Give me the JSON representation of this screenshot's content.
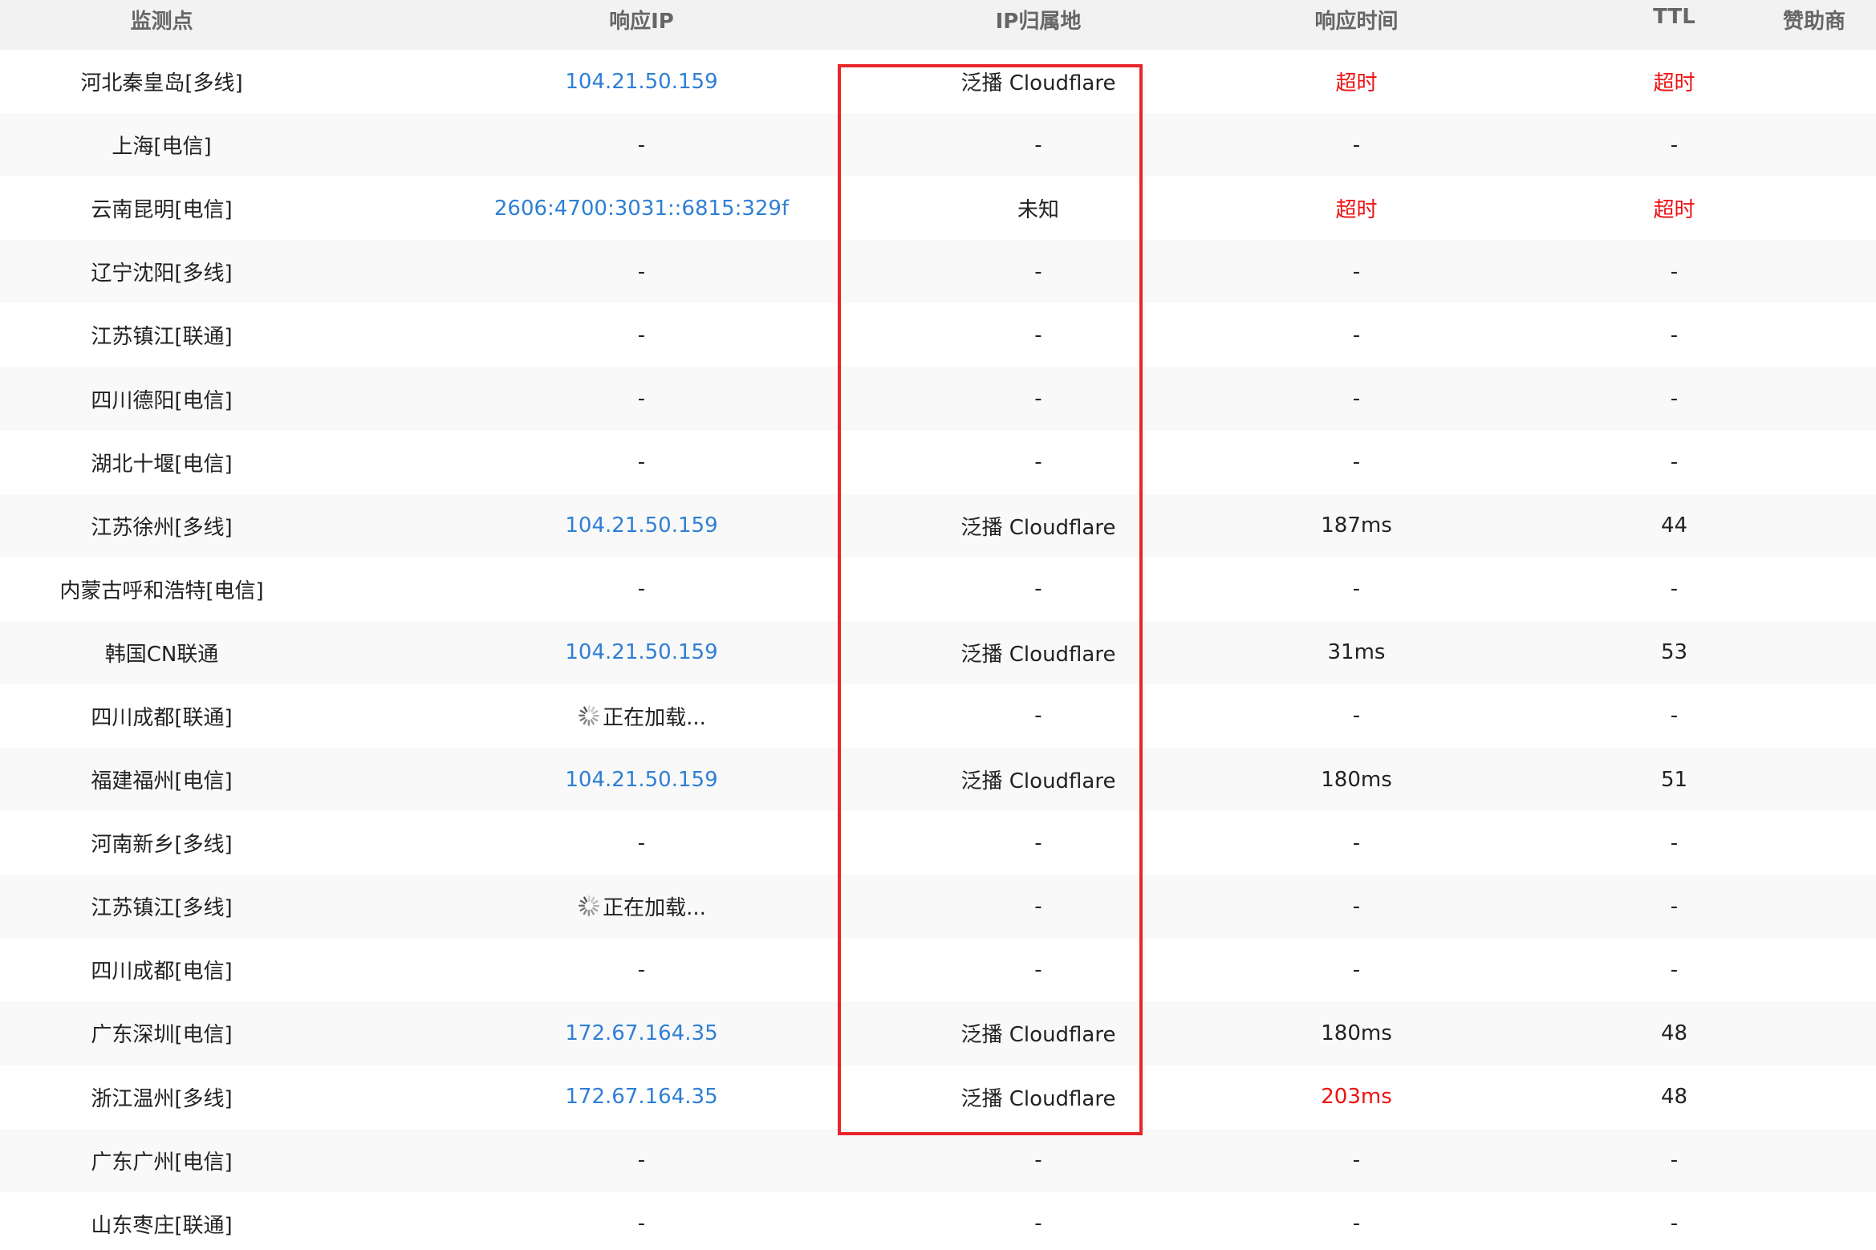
{
  "colors": {
    "link": "#2f7fd5",
    "timeout": "#ee1111",
    "highlight": "#e8262a",
    "header_bg": "#f2f2f2"
  },
  "headers": {
    "node": "监测点",
    "ip": "响应IP",
    "location": "IP归属地",
    "time": "响应时间",
    "ttl": "TTL",
    "sponsor": "赞助商"
  },
  "rows": [
    {
      "node": "河北秦皇岛[多线]",
      "ip": "104.21.50.159",
      "location": "泛播 Cloudflare",
      "time": "超时",
      "ttl": "超时",
      "time_color": "#ee1111",
      "ttl_color": "#ee1111"
    },
    {
      "node": "上海[电信]",
      "ip": "-",
      "location": "-",
      "time": "-",
      "ttl": "-"
    },
    {
      "node": "云南昆明[电信]",
      "ip": "2606:4700:3031::6815:329f",
      "location": "未知",
      "time": "超时",
      "ttl": "超时",
      "time_color": "#ee1111",
      "ttl_color": "#ee1111"
    },
    {
      "node": "辽宁沈阳[多线]",
      "ip": "-",
      "location": "-",
      "time": "-",
      "ttl": "-"
    },
    {
      "node": "江苏镇江[联通]",
      "ip": "-",
      "location": "-",
      "time": "-",
      "ttl": "-"
    },
    {
      "node": "四川德阳[电信]",
      "ip": "-",
      "location": "-",
      "time": "-",
      "ttl": "-"
    },
    {
      "node": "湖北十堰[电信]",
      "ip": "-",
      "location": "-",
      "time": "-",
      "ttl": "-"
    },
    {
      "node": "江苏徐州[多线]",
      "ip": "104.21.50.159",
      "location": "泛播 Cloudflare",
      "time": "187ms",
      "ttl": "44"
    },
    {
      "node": "内蒙古呼和浩特[电信]",
      "ip": "-",
      "location": "-",
      "time": "-",
      "ttl": "-"
    },
    {
      "node": "韩国CN联通",
      "ip": "104.21.50.159",
      "location": "泛播 Cloudflare",
      "time": "31ms",
      "ttl": "53"
    },
    {
      "node": "四川成都[联通]",
      "ip": "正在加载...",
      "loading": true,
      "location": "-",
      "time": "-",
      "ttl": "-"
    },
    {
      "node": "福建福州[电信]",
      "ip": "104.21.50.159",
      "location": "泛播 Cloudflare",
      "time": "180ms",
      "ttl": "51"
    },
    {
      "node": "河南新乡[多线]",
      "ip": "-",
      "location": "-",
      "time": "-",
      "ttl": "-"
    },
    {
      "node": "江苏镇江[多线]",
      "ip": "正在加载...",
      "loading": true,
      "location": "-",
      "time": "-",
      "ttl": "-"
    },
    {
      "node": "四川成都[电信]",
      "ip": "-",
      "location": "-",
      "time": "-",
      "ttl": "-"
    },
    {
      "node": "广东深圳[电信]",
      "ip": "172.67.164.35",
      "location": "泛播 Cloudflare",
      "time": "180ms",
      "ttl": "48"
    },
    {
      "node": "浙江温州[多线]",
      "ip": "172.67.164.35",
      "location": "泛播 Cloudflare",
      "time": "203ms",
      "ttl": "48",
      "time_color": "#ee1111"
    },
    {
      "node": "广东广州[电信]",
      "ip": "-",
      "location": "-",
      "time": "-",
      "ttl": "-"
    },
    {
      "node": "山东枣庄[联通]",
      "ip": "-",
      "location": "-",
      "time": "-",
      "ttl": "-"
    }
  ]
}
